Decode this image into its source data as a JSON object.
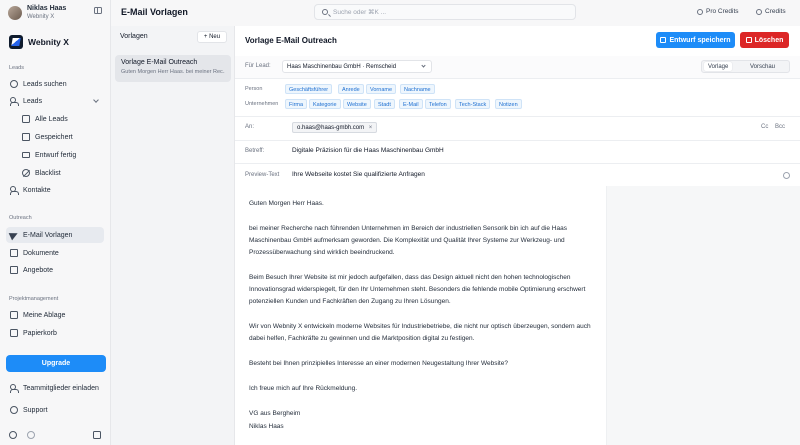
{
  "user": {
    "name": "Niklas Haas",
    "company": "Webnity X"
  },
  "brand": {
    "name": "Webnity X"
  },
  "sidebar": {
    "sections": {
      "leads": "Leads",
      "outreach": "Outreach",
      "project": "Projektmanagement"
    },
    "items": {
      "leads_search": "Leads suchen",
      "leads": "Leads",
      "all_leads": "Alle Leads",
      "saved": "Gespeichert",
      "draft_done": "Entwurf fertig",
      "blacklist": "Blacklist",
      "contacts": "Kontakte",
      "email_templates": "E-Mail Vorlagen",
      "documents": "Dokumente",
      "offers": "Angebote",
      "my_storage": "Meine Ablage",
      "trash": "Papierkorb"
    },
    "upgrade": "Upgrade",
    "invite": "Teammitglieder einladen",
    "support": "Support"
  },
  "header": {
    "title": "E-Mail Vorlagen",
    "search_placeholder": "Suche oder ⌘K ...",
    "pro_credits": "Pro Credits",
    "credits": "Credits"
  },
  "templates": {
    "title": "Vorlagen",
    "new_label": "+ Neu",
    "items": [
      {
        "title": "Vorlage E-Mail Outreach",
        "preview": "Guten Morgen Herr Haas. bei meiner Rec..."
      }
    ]
  },
  "editor": {
    "title": "Vorlage E-Mail Outreach",
    "save_label": "Entwurf speichern",
    "delete_label": "Löschen",
    "lead_label": "Für Lead:",
    "lead_value": "Haas Maschinenbau GmbH · Remscheid",
    "view_template": "Vorlage",
    "view_preview": "Vorschau",
    "vars": {
      "person_label": "Person",
      "person": [
        "Geschäftsführer",
        "Anrede",
        "Vorname",
        "Nachname"
      ],
      "company_label": "Unternehmen",
      "company": [
        "Firma",
        "Kategorie",
        "Website",
        "Stadt",
        "E-Mail",
        "Telefon",
        "Tech-Stack",
        "Notizen"
      ]
    },
    "to_label": "An:",
    "to_value": "o.haas@haas-gmbh.com",
    "cc": "Cc",
    "bcc": "Bcc",
    "subject_label": "Betreff:",
    "subject_value": "Digitale Präzision für die Haas Maschinenbau GmbH",
    "preview_label": "Preview-Text",
    "preview_value": "Ihre Webseite kostet Sie qualifizierte Anfragen",
    "body": {
      "p1": "Guten Morgen Herr Haas.",
      "p2": "bei meiner Recherche nach führenden Unternehmen im Bereich der industriellen Sensorik bin ich auf die Haas Maschinenbau GmbH aufmerksam geworden. Die Komplexität und Qualität Ihrer Systeme zur Werkzeug- und Prozessüberwachung sind wirklich beeindruckend.",
      "p3": "Beim Besuch Ihrer Website ist mir jedoch aufgefallen, dass das Design aktuell nicht den hohen technologischen Innovationsgrad widerspiegelt, für den Ihr Unternehmen steht. Besonders die fehlende mobile Optimierung erschwert potenziellen Kunden und Fachkräften den Zugang zu Ihren Lösungen.",
      "p4": "Wir von Webnity X entwickeln moderne Websites für Industriebetriebe, die nicht nur optisch überzeugen, sondern auch dabei helfen, Fachkräfte zu gewinnen und die Marktposition digital zu festigen.",
      "p5": "Besteht bei Ihnen prinzipielles Interesse an einer modernen Neugestaltung Ihrer Website?",
      "p6": "Ich freue mich auf Ihre Rückmeldung.",
      "sig1": "VG aus Bergheim",
      "sig2": "Niklas Haas"
    }
  },
  "colors": {
    "primary": "#1d8cf8",
    "danger": "#dc2626",
    "chip_text": "#1d6fd1"
  }
}
